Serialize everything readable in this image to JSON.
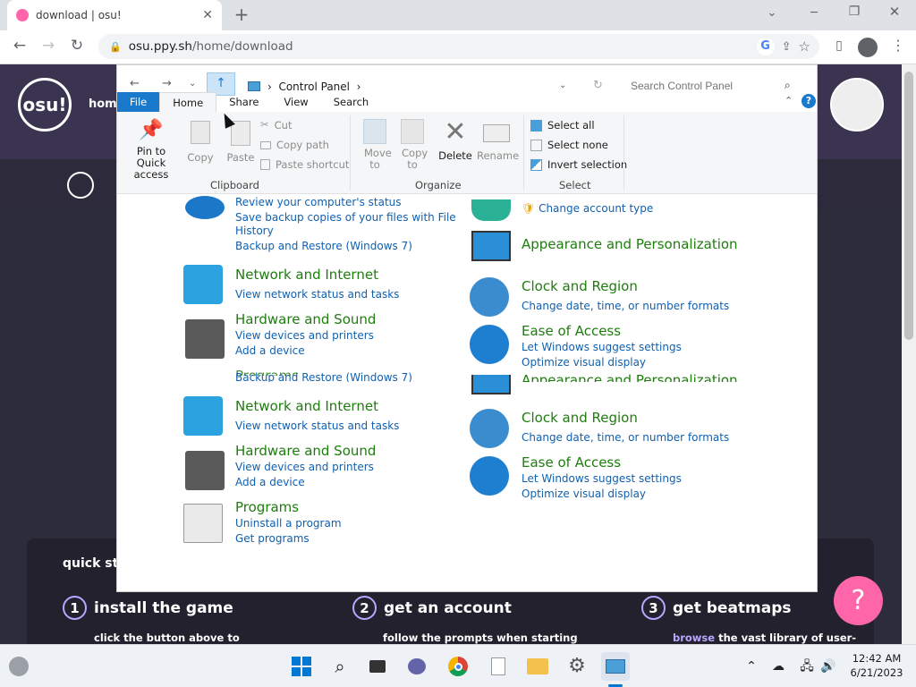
{
  "browser": {
    "tab_title": "download | osu!",
    "new_tab_glyph": "+",
    "url_host": "osu.ppy.sh",
    "url_path": "/home/download",
    "colors": {
      "accent": "#ff66aa",
      "chrome_bg": "#dee1e6"
    }
  },
  "osu": {
    "logo": "osu!",
    "nav_home": "home",
    "quick_start": "quick st",
    "steps": [
      {
        "num": "1",
        "label": "install the game",
        "sub": "click the button above to"
      },
      {
        "num": "2",
        "label": "get an account",
        "sub": "follow the prompts when starting"
      },
      {
        "num": "3",
        "label": "get beatmaps",
        "sub_link": "browse",
        "sub": " the vast library of user-"
      }
    ],
    "help_glyph": "?"
  },
  "explorer": {
    "breadcrumb": "Control Panel",
    "search_placeholder": "Search Control Panel",
    "ribbon_tabs": [
      {
        "label": "File"
      },
      {
        "label": "Home"
      },
      {
        "label": "Share"
      },
      {
        "label": "View"
      },
      {
        "label": "Search"
      }
    ],
    "ribbon": {
      "pin": "Pin to Quick access",
      "copy": "Copy",
      "paste": "Paste",
      "cut": "Cut",
      "copy_path": "Copy path",
      "paste_shortcut": "Paste shortcut",
      "move_to": "Move to",
      "copy_to": "Copy to",
      "delete": "Delete",
      "rename": "Rename",
      "select_all": "Select all",
      "select_none": "Select none",
      "invert_selection": "Invert selection",
      "group_clipboard": "Clipboard",
      "group_organize": "Organize",
      "group_select": "Select"
    },
    "left_col": {
      "sys_link1": "Review your computer's status",
      "sys_link2": "Save backup copies of your files with File",
      "sys_link2b": "History",
      "sys_link3": "Backup and Restore (Windows 7)",
      "net_title": "Network and Internet",
      "net_link": "View network status and tasks",
      "hw_title": "Hardware and Sound",
      "hw_link1": "View devices and printers",
      "hw_link2": "Add a device",
      "ghost_programs": "Programs",
      "ghost_backup": "Backup and Restore (Windows 7)",
      "net2_title": "Network and Internet",
      "net2_link": "View network status and tasks",
      "hw2_title": "Hardware and Sound",
      "hw2_link1": "View devices and printers",
      "hw2_link2": "Add a device",
      "prog_title": "Programs",
      "prog_link1": "Uninstall a program",
      "prog_link2": "Get programs"
    },
    "right_col": {
      "acct_link": "Change account type",
      "app_title": "Appearance and Personalization",
      "clock_title": "Clock and Region",
      "clock_link": "Change date, time, or number formats",
      "ease_title": "Ease of Access",
      "ease_link1": "Let Windows suggest settings",
      "ease_link2": "Optimize visual display",
      "ghost_app": "Appearance and Personalization",
      "clock2_title": "Clock and Region",
      "clock2_link": "Change date, time, or number formats",
      "ease2_title": "Ease of Access",
      "ease2_link1": "Let Windows suggest settings",
      "ease2_link2": "Optimize visual display"
    }
  },
  "taskbar": {
    "time": "12:42 AM",
    "date": "6/21/2023"
  }
}
